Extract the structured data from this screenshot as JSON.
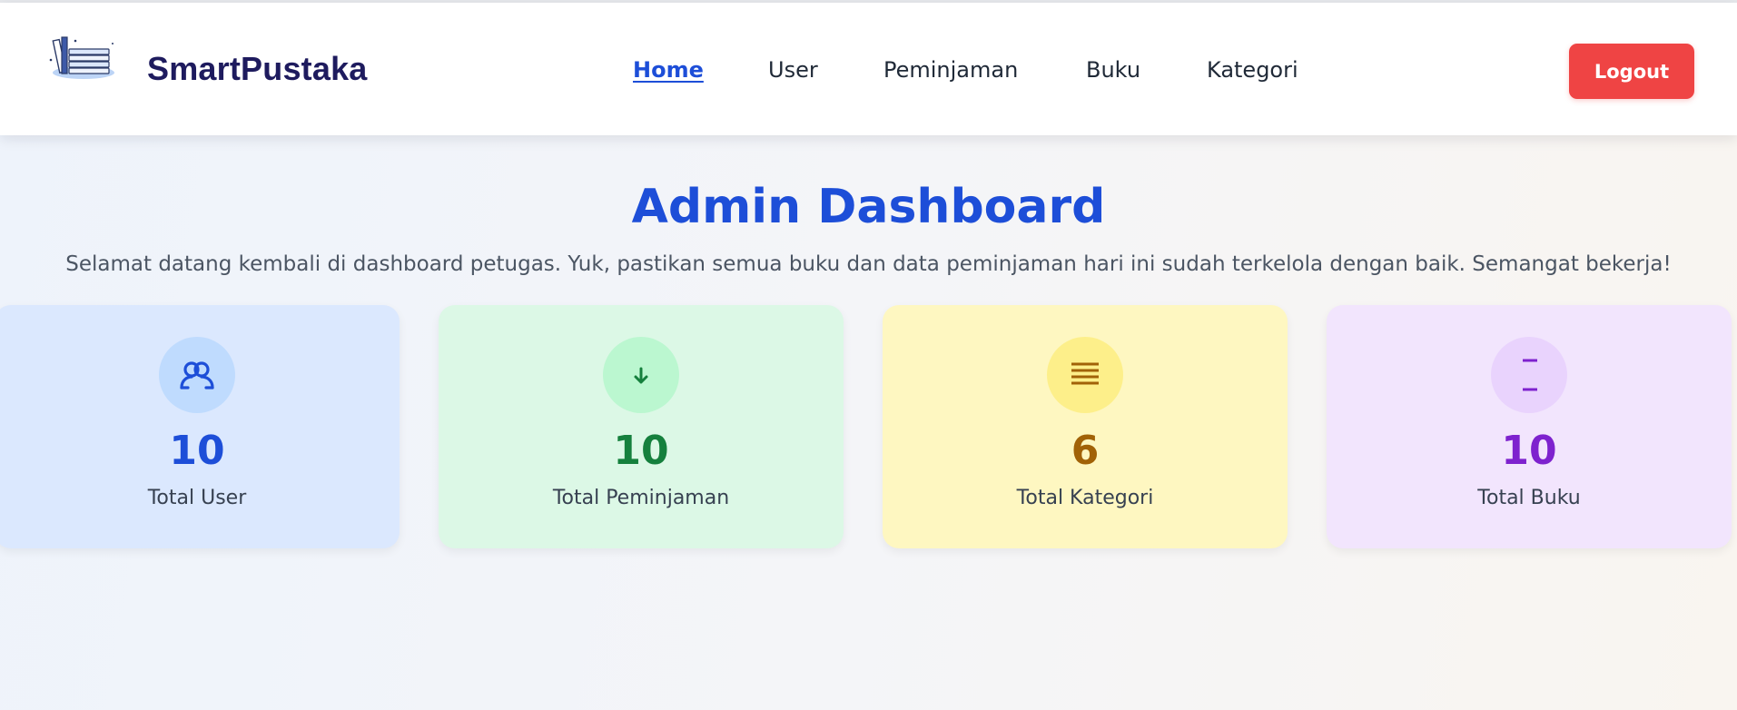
{
  "navbar": {
    "brand": "SmartPustaka",
    "links": [
      {
        "label": "Home",
        "active": true
      },
      {
        "label": "User",
        "active": false
      },
      {
        "label": "Peminjaman",
        "active": false
      },
      {
        "label": "Buku",
        "active": false
      },
      {
        "label": "Kategori",
        "active": false
      }
    ],
    "logout_label": "Logout",
    "logout_color": "#ef4444"
  },
  "main": {
    "title": "Admin Dashboard",
    "subtitle": "Selamat datang kembali di dashboard petugas. Yuk, pastikan semua buku dan data peminjaman hari ini sudah terkelola dengan baik. Semangat bekerja!",
    "cards": [
      {
        "value": "10",
        "label": "Total User",
        "icon": "users-icon",
        "color": "#1d4ed8"
      },
      {
        "value": "10",
        "label": "Total Peminjaman",
        "icon": "arrow-down-icon",
        "color": "#15803d"
      },
      {
        "value": "6",
        "label": "Total Kategori",
        "icon": "list-icon",
        "color": "#a16207"
      },
      {
        "value": "10",
        "label": "Total Buku",
        "icon": "book-icon",
        "color": "#7e22ce"
      }
    ]
  }
}
